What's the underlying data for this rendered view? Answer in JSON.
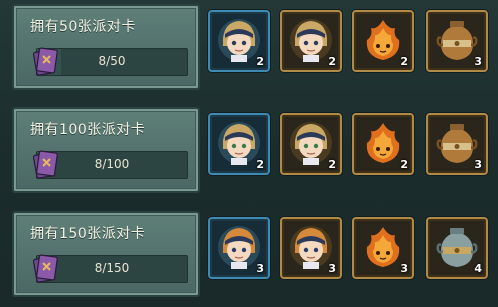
{
  "rows": [
    {
      "title": "拥有50张派对卡",
      "progress": "8/50",
      "progress_fraction": 0.16,
      "rewards": [
        {
          "icon": "hero-avatar-icon",
          "qty": "2",
          "frame": "blue"
        },
        {
          "icon": "hero-avatar-icon",
          "qty": "2",
          "frame": "gold"
        },
        {
          "icon": "fire-spirit-icon",
          "qty": "2",
          "frame": "gold"
        },
        {
          "icon": "jar-icon",
          "qty": "3",
          "frame": "gold"
        }
      ]
    },
    {
      "title": "拥有100张派对卡",
      "progress": "8/100",
      "progress_fraction": 0.08,
      "rewards": [
        {
          "icon": "hero-avatar-icon",
          "qty": "2",
          "frame": "blue"
        },
        {
          "icon": "hero-avatar-icon",
          "qty": "2",
          "frame": "gold"
        },
        {
          "icon": "fire-spirit-icon",
          "qty": "2",
          "frame": "gold"
        },
        {
          "icon": "jar-icon",
          "qty": "3",
          "frame": "gold"
        }
      ]
    },
    {
      "title": "拥有150张派对卡",
      "progress": "8/150",
      "progress_fraction": 0.053,
      "rewards": [
        {
          "icon": "hero-avatar-icon",
          "qty": "3",
          "frame": "blue"
        },
        {
          "icon": "hero-avatar-icon",
          "qty": "3",
          "frame": "gold"
        },
        {
          "icon": "fire-spirit-icon",
          "qty": "3",
          "frame": "gold"
        },
        {
          "icon": "jar-icon",
          "qty": "4",
          "frame": "gold"
        }
      ]
    }
  ],
  "colors": {
    "background": "#1d2f2f",
    "panel": "#557470",
    "frame_blue": "#3f8ab0",
    "frame_gold": "#b08a46"
  }
}
